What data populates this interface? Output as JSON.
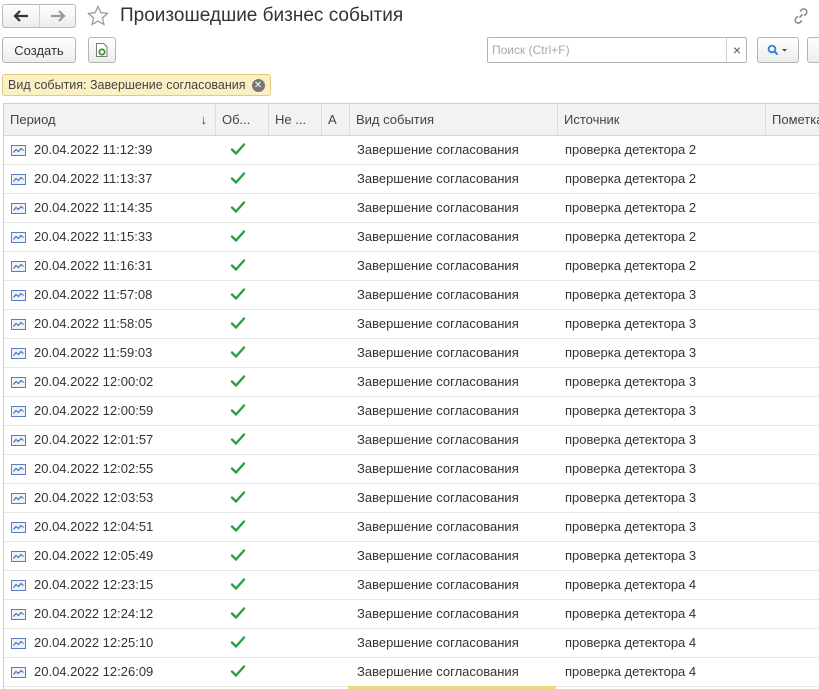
{
  "window": {
    "title": "Произошедшие бизнес события"
  },
  "toolbar": {
    "create_label": "Создать",
    "search_placeholder": "Поиск (Ctrl+F)",
    "search_clear": "×"
  },
  "filter": {
    "label": "Вид события: Завершение согласования"
  },
  "table": {
    "columns": [
      "Период",
      "Об...",
      "Не ...",
      "А",
      "Вид события",
      "Источник",
      "Пометка"
    ],
    "sort_indicator": "↓",
    "rows": [
      {
        "period": "20.04.2022 11:12:39",
        "processed": true,
        "event": "Завершение согласования",
        "source": "проверка детектора 2"
      },
      {
        "period": "20.04.2022 11:13:37",
        "processed": true,
        "event": "Завершение согласования",
        "source": "проверка детектора 2"
      },
      {
        "period": "20.04.2022 11:14:35",
        "processed": true,
        "event": "Завершение согласования",
        "source": "проверка детектора 2"
      },
      {
        "period": "20.04.2022 11:15:33",
        "processed": true,
        "event": "Завершение согласования",
        "source": "проверка детектора 2"
      },
      {
        "period": "20.04.2022 11:16:31",
        "processed": true,
        "event": "Завершение согласования",
        "source": "проверка детектора 2"
      },
      {
        "period": "20.04.2022 11:57:08",
        "processed": true,
        "event": "Завершение согласования",
        "source": "проверка детектора 3"
      },
      {
        "period": "20.04.2022 11:58:05",
        "processed": true,
        "event": "Завершение согласования",
        "source": "проверка детектора 3"
      },
      {
        "period": "20.04.2022 11:59:03",
        "processed": true,
        "event": "Завершение согласования",
        "source": "проверка детектора 3"
      },
      {
        "period": "20.04.2022 12:00:02",
        "processed": true,
        "event": "Завершение согласования",
        "source": "проверка детектора 3"
      },
      {
        "period": "20.04.2022 12:00:59",
        "processed": true,
        "event": "Завершение согласования",
        "source": "проверка детектора 3"
      },
      {
        "period": "20.04.2022 12:01:57",
        "processed": true,
        "event": "Завершение согласования",
        "source": "проверка детектора 3"
      },
      {
        "period": "20.04.2022 12:02:55",
        "processed": true,
        "event": "Завершение согласования",
        "source": "проверка детектора 3"
      },
      {
        "period": "20.04.2022 12:03:53",
        "processed": true,
        "event": "Завершение согласования",
        "source": "проверка детектора 3"
      },
      {
        "period": "20.04.2022 12:04:51",
        "processed": true,
        "event": "Завершение согласования",
        "source": "проверка детектора 3"
      },
      {
        "period": "20.04.2022 12:05:49",
        "processed": true,
        "event": "Завершение согласования",
        "source": "проверка детектора 3"
      },
      {
        "period": "20.04.2022 12:23:15",
        "processed": true,
        "event": "Завершение согласования",
        "source": "проверка детектора 4"
      },
      {
        "period": "20.04.2022 12:24:12",
        "processed": true,
        "event": "Завершение согласования",
        "source": "проверка детектора 4"
      },
      {
        "period": "20.04.2022 12:25:10",
        "processed": true,
        "event": "Завершение согласования",
        "source": "проверка детектора 4"
      },
      {
        "period": "20.04.2022 12:26:09",
        "processed": true,
        "event": "Завершение согласования",
        "source": "проверка детектора 4"
      }
    ]
  },
  "icons": {
    "back": "arrow-left-icon",
    "forward": "arrow-right-icon",
    "favorite": "star-icon",
    "link": "link-icon",
    "add": "add-document-icon",
    "search": "search-icon",
    "record": "record-icon",
    "check": "check-icon"
  },
  "colors": {
    "check": "#2e9e46",
    "chip_bg": "#fbf0c4",
    "search_icon": "#2a7fd4"
  }
}
